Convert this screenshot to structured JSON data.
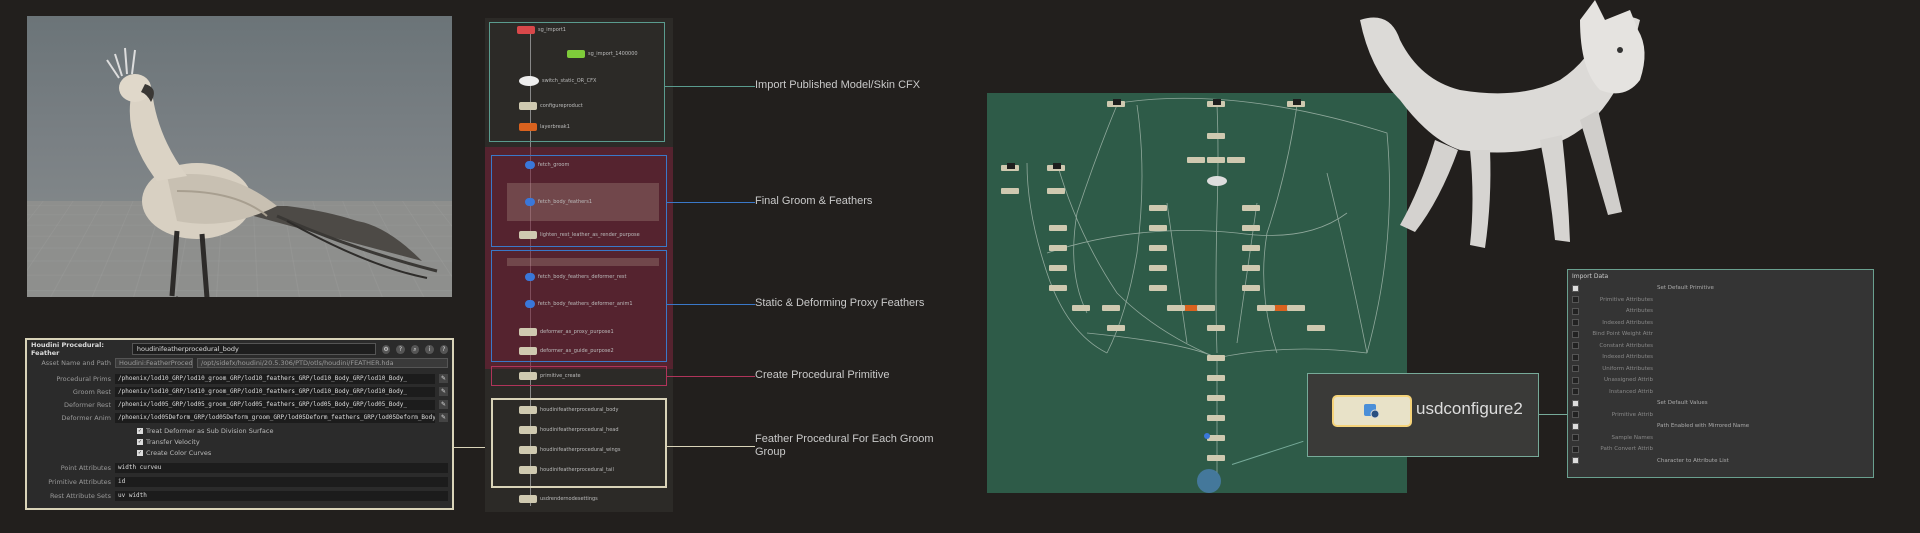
{
  "param_panel": {
    "node_type": "Houdini Procedural: Feather",
    "node_name": "houdinifeatherprocedural_body",
    "asset_label": "Asset Name and Path",
    "asset_name": "Houdini:FeatherProcedural",
    "asset_path": "/opt/sidefx/houdini/20.5.306/PTD/otls/houdini/FEATHER.hda",
    "rows": [
      {
        "label": "Procedural Prims",
        "value": "/phoenix/lod10_GRP/lod10_groom_GRP/lod10_feathers_GRP/lod10_Body_GRP/lod10_Body_"
      },
      {
        "label": "Groom Rest",
        "value": "/phoenix/lod10_GRP/lod10_groom_GRP/lod10_feathers_GRP/lod10_Body_GRP/lod10_Body_"
      },
      {
        "label": "Deformer Rest",
        "value": "/phoenix/lod05_GRP/lod05_groom_GRP/lod05_feathers_GRP/lod05_Body_GRP/lod05_Body_"
      },
      {
        "label": "Deformer Anim",
        "value": "/phoenix/lod05Deform_GRP/lod05Deform_groom_GRP/lod05Deform_feathers_GRP/lod05Deform_Body_GRP/lod05Be"
      }
    ],
    "checks": [
      "Treat Deformer as Sub Division Surface",
      "Transfer Velocity",
      "Create Color Curves"
    ],
    "rows2": [
      {
        "label": "Point Attributes",
        "value": "width curveu"
      },
      {
        "label": "Primitive Attributes",
        "value": "id"
      },
      {
        "label": "Rest Attribute Sets",
        "value": "uv width"
      }
    ]
  },
  "graph1": {
    "nodes": [
      {
        "name": "sg_import1",
        "color": "red"
      },
      {
        "name": "sg_import_1400000",
        "color": "green"
      },
      {
        "name": "switch_static_OR_CFX",
        "color": "white"
      },
      {
        "name": "configureproduct",
        "color": "beige"
      },
      {
        "name": "layerbreak1",
        "color": "orange"
      },
      {
        "name": "fetch_groom",
        "color": "blue"
      },
      {
        "name": "fetch_body_feathers1",
        "color": "blue"
      },
      {
        "name": "lighten_rest_leather_as_render_purpose",
        "color": "beige"
      },
      {
        "name": "fetch_body_feathers_deformer_rest",
        "color": "blue"
      },
      {
        "name": "fetch_body_feathers_deformer_anim1",
        "color": "blue"
      },
      {
        "name": "deformer_as_proxy_purpose1",
        "color": "beige"
      },
      {
        "name": "deformer_as_guide_purpose2",
        "color": "beige"
      },
      {
        "name": "primitive_create",
        "color": "beige"
      },
      {
        "name": "houdinifeatherprocedural_body",
        "color": "beige"
      },
      {
        "name": "houdinifeatherprocedural_head",
        "color": "beige"
      },
      {
        "name": "houdinifeatherprocedural_wings",
        "color": "beige"
      },
      {
        "name": "houdinifeatherprocedural_tail",
        "color": "beige"
      },
      {
        "name": "usdrendernodesettings",
        "color": "beige"
      }
    ]
  },
  "callouts": [
    {
      "text": "Import Published Model/Skin CFX",
      "color": "#5a9b8e"
    },
    {
      "text": "Final Groom & Feathers",
      "color": "#3a78c8"
    },
    {
      "text": "Static & Deforming Proxy Feathers",
      "color": "#3a78c8"
    },
    {
      "text": "Create Procedural Primitive",
      "color": "#b0345a"
    },
    {
      "text": "Feather Procedural For Each Groom Group",
      "color": "#d9d3b8"
    }
  ],
  "zoom": {
    "label": "usdconfigure2"
  },
  "import_panel": {
    "title": "Import Data",
    "rows": [
      {
        "label": "",
        "value": "Set Default Primitive",
        "on": true
      },
      {
        "label": "Primitive Attributes",
        "value": "",
        "on": false
      },
      {
        "label": "Attributes",
        "value": "",
        "on": false
      },
      {
        "label": "Indexed Attributes",
        "value": "",
        "on": false
      },
      {
        "label": "Bind Point Weight Attr",
        "value": "",
        "on": false
      },
      {
        "label": "Constant Attributes",
        "value": "",
        "on": false
      },
      {
        "label": "Indexed Attributes",
        "value": "",
        "on": false
      },
      {
        "label": "Uniform Attributes",
        "value": "",
        "on": false
      },
      {
        "label": "Unassigned Attrib",
        "value": "",
        "on": false
      },
      {
        "label": "Instanced Attrib",
        "value": "",
        "on": false
      },
      {
        "label": "",
        "value": "Set Default Values",
        "on": true
      },
      {
        "label": "Primitive Attrib",
        "value": "",
        "on": false
      },
      {
        "label": "",
        "value": "Path Enabled with Mirrored Name",
        "on": true
      },
      {
        "label": "Sample Names",
        "value": "",
        "on": false
      },
      {
        "label": "Path Convert Attrib",
        "value": "",
        "on": false
      },
      {
        "label": "",
        "value": "Character to Attribute List",
        "on": true
      }
    ]
  },
  "colors": {
    "graph_green": "#2e5b48",
    "node_beige": "#cfc9b0",
    "accent_yellow": "#f5d37a"
  }
}
